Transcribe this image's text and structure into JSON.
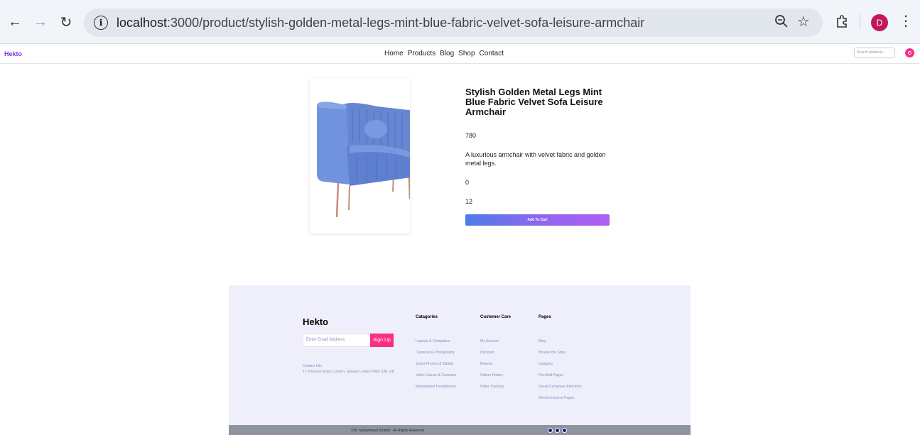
{
  "browser": {
    "url_host": "localhost",
    "url_path": ":3000/product/stylish-golden-metal-legs-mint-blue-fabric-velvet-sofa-leisure-armchair",
    "profile_initial": "D"
  },
  "header": {
    "logo": "Hekto",
    "nav": [
      "Home",
      "Products",
      "Blog",
      "Shop",
      "Contact"
    ],
    "search_placeholder": "Search products..."
  },
  "product": {
    "title": "Stylish Golden Metal Legs Mint Blue Fabric Velvet Sofa Leisure Armchair",
    "price": "780",
    "description": "A luxurious armchair with velvet fabric and golden metal legs.",
    "value_1": "0",
    "value_2": "12",
    "add_to_cart": "Add To Cart",
    "image_colors": {
      "fabric": "#6e8fd9",
      "legs": "#c98a7c"
    }
  },
  "footer": {
    "logo": "Hekto",
    "email_placeholder": "Enter Email Address",
    "signup": "Sign Up",
    "contact_label": "Contact Info",
    "address": "17 Princess Road, London, Greater London NW1 8JR, UK",
    "columns": [
      {
        "heading": "Catagories",
        "items": [
          "Laptops & Computers",
          "Cameras & Photography",
          "Smart Phones & Tablets",
          "Video Games & Consoles",
          "Waterpproof Headphones"
        ]
      },
      {
        "heading": "Customer Care",
        "items": [
          "My Account",
          "Discount",
          "Returns",
          "Orders History",
          "Order Tracking"
        ]
      },
      {
        "heading": "Pages",
        "items": [
          "Blog",
          "Browse the Shop",
          "Category",
          "Pre-Built Pages",
          "Visual Composer Elements",
          "WooCommerce Pages"
        ]
      }
    ],
    "copyright": "©Dr. Muhammad Shahid - All Rights Reserved",
    "accent": "#fb2e86"
  }
}
